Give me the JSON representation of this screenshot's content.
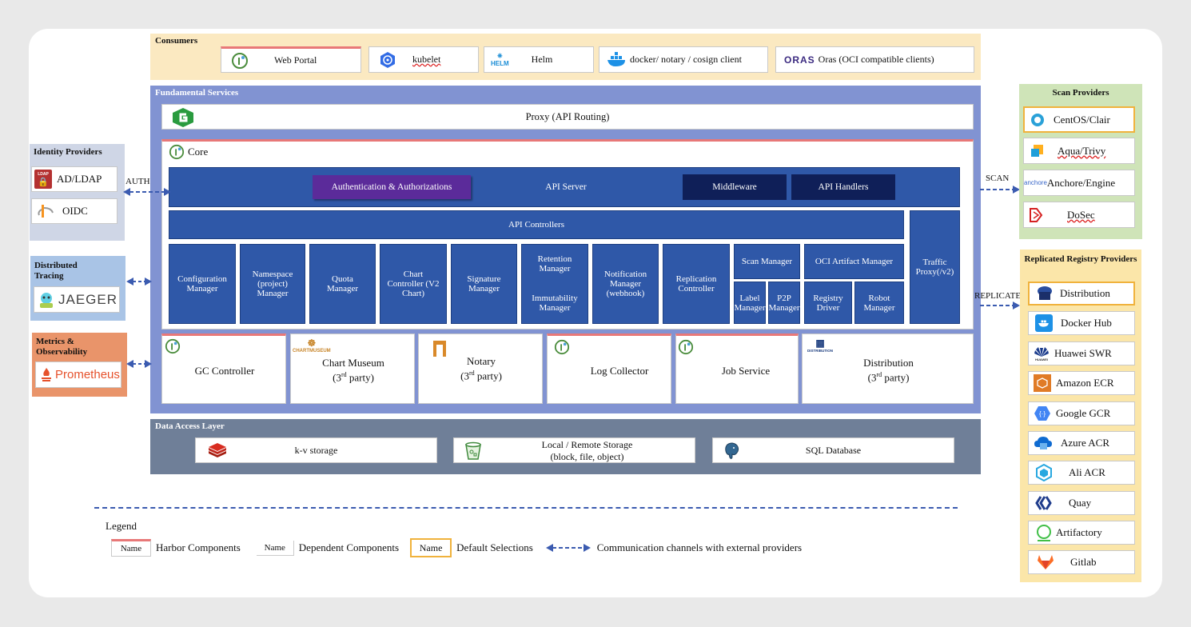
{
  "consumers": {
    "title": "Consumers",
    "items": [
      "Web Portal",
      "kubelet",
      "Helm",
      "docker/ notary / cosign client",
      "Oras (OCI compatible clients)"
    ],
    "helm_logo_text": "HELM",
    "oras_logo_text": "ORAS"
  },
  "fundamental": {
    "title": "Fundamental Services",
    "proxy": "Proxy (API Routing)",
    "core": "Core",
    "authn": "Authentication & Authorizations",
    "api_server": "API Server",
    "middleware": "Middleware",
    "api_handlers": "API Handlers",
    "api_controllers": "API Controllers",
    "traffic_proxy": "Traffic Proxy(/v2)",
    "managers": {
      "config": "Configuration Manager",
      "namespace": "Namespace (project) Manager",
      "quota": "Quota Manager",
      "chart": "Chart Controller (V2 Chart)",
      "signature": "Signature Manager",
      "retention": "Retention Manager",
      "immutability": "Immutability Manager",
      "notification": "Notification Manager (webhook)",
      "replication": "Replication Controller",
      "scan": "Scan Manager",
      "label": "Label Manager",
      "p2p": "P2P Manager",
      "oci": "OCI Artifact Manager",
      "registry_driver": "Registry Driver",
      "robot": "Robot Manager"
    },
    "services": {
      "gc": "GC Controller",
      "chartmuseum": "Chart Museum",
      "chartmuseum_logo": "CHARTMUSEUM",
      "notary": "Notary",
      "log": "Log Collector",
      "job": "Job Service",
      "distribution": "Distribution",
      "distribution_logo": "DISTRIBUTION",
      "third": "3",
      "third_sup": "rd",
      "third_rest": " party)",
      "paren": "("
    }
  },
  "data_access": {
    "title": "Data Access Layer",
    "kv": "k-v storage",
    "storage_line1": "Local / Remote Storage",
    "storage_line2": "(block, file, object)",
    "sql": "SQL Database"
  },
  "identity": {
    "title": "Identity Providers",
    "items": [
      "AD/LDAP",
      "OIDC"
    ],
    "ldap_logo": "LDAP",
    "channel": "AUTH"
  },
  "tracing": {
    "title": "Distributed Tracing",
    "name": "JAEGER"
  },
  "metrics": {
    "title": "Metrics & Observability",
    "name": "Prometheus"
  },
  "scan": {
    "title": "Scan Providers",
    "channel": "SCAN",
    "items": [
      "CentOS/Clair",
      "Aqua/Trivy",
      "Anchore/Engine",
      "DoSec"
    ],
    "anchore_logo": "anchore"
  },
  "replicated": {
    "title": "Replicated Registry Providers",
    "channel": "REPLICATE",
    "items": [
      "Distribution",
      "Docker Hub",
      "Huawei SWR",
      "Amazon ECR",
      "Google GCR",
      "Azure ACR",
      "Ali ACR",
      "Quay",
      "Artifactory",
      "Gitlab"
    ],
    "huawei_logo": "HUAWEI"
  },
  "legend": {
    "title": "Legend",
    "sample": "Name",
    "harbor": "Harbor Components",
    "dependent": "Dependent Components",
    "default": "Default Selections",
    "channel": "Communication channels with external providers"
  },
  "colors": {
    "consumers_bg": "#fbe9c1",
    "fundamental_bg": "#8193d2",
    "core_blue": "#2f58a8",
    "navy": "#0f1f58",
    "purple": "#5b2b9a",
    "data_layer_bg": "#6f7f98",
    "identity_bg": "#cfd6e6",
    "tracing_bg": "#a9c4e6",
    "metrics_bg": "#e9946a",
    "scan_bg": "#cfe4b8",
    "replicated_bg": "#fbe6a9",
    "harbor_red": "#e87878",
    "default_yellow": "#f0b23c"
  }
}
